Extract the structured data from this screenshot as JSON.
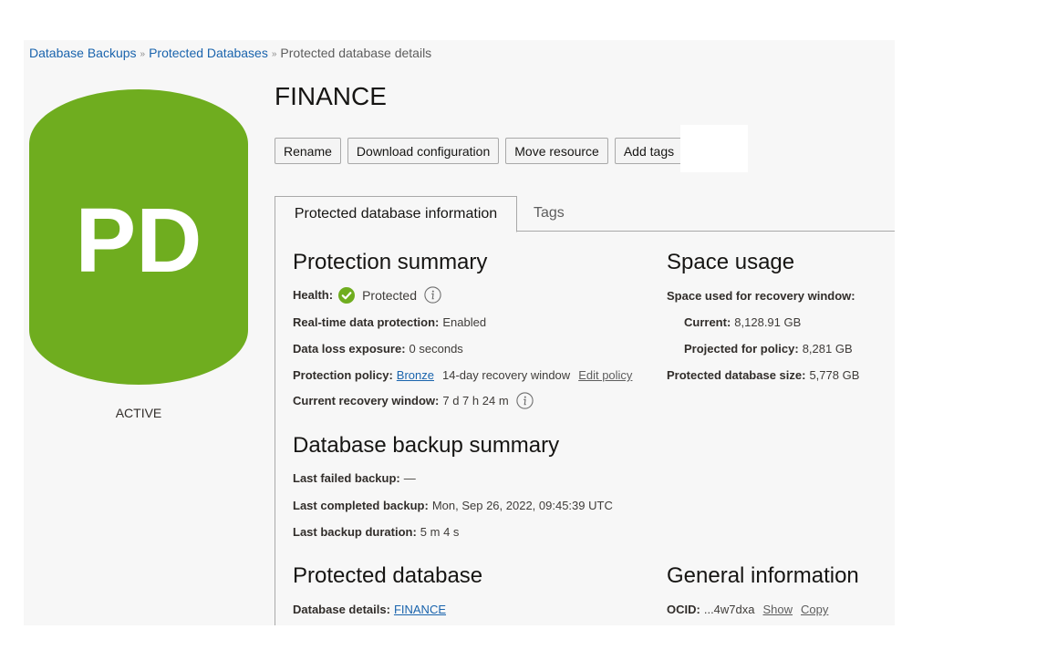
{
  "breadcrumb": {
    "items": [
      "Database Backups",
      "Protected Databases"
    ],
    "separator": "»",
    "current": "Protected database details"
  },
  "resource": {
    "initials": "PD",
    "state": "ACTIVE",
    "title": "FINANCE",
    "icon_color": "#6fad1f"
  },
  "actions": {
    "rename": "Rename",
    "download": "Download configuration",
    "move": "Move resource",
    "tags": "Add tags"
  },
  "tabs": {
    "info": "Protected database information",
    "tags": "Tags"
  },
  "protection_summary": {
    "title": "Protection summary",
    "health_label": "Health:",
    "health_value": "Protected",
    "realtime_label": "Real-time data protection:",
    "realtime_value": "Enabled",
    "loss_label": "Data loss exposure:",
    "loss_value": "0 seconds",
    "policy_label": "Protection policy:",
    "policy_value": "Bronze",
    "policy_window": "14-day recovery window",
    "policy_edit": "Edit policy",
    "window_label": "Current recovery window:",
    "window_value": "7 d 7 h 24 m"
  },
  "space_usage": {
    "title": "Space usage",
    "used_label": "Space used for recovery window:",
    "current_label": "Current:",
    "current_value": "8,128.91 GB",
    "projected_label": "Projected for policy:",
    "projected_value": "8,281 GB",
    "size_label": "Protected database size:",
    "size_value": "5,778 GB"
  },
  "backup_summary": {
    "title": "Database backup summary",
    "failed_label": "Last failed backup:",
    "failed_value": "—",
    "completed_label": "Last completed backup:",
    "completed_value": "Mon, Sep 26, 2022, 09:45:39 UTC",
    "duration_label": "Last backup duration:",
    "duration_value": "5 m 4 s"
  },
  "protected_database": {
    "title": "Protected database",
    "details_label": "Database details:",
    "details_value": "FINANCE"
  },
  "general_information": {
    "title": "General information",
    "ocid_label": "OCID:",
    "ocid_value": "...4w7dxa",
    "show": "Show",
    "copy": "Copy"
  },
  "colors": {
    "link": "#1a64ad",
    "success": "#6fad1f"
  }
}
